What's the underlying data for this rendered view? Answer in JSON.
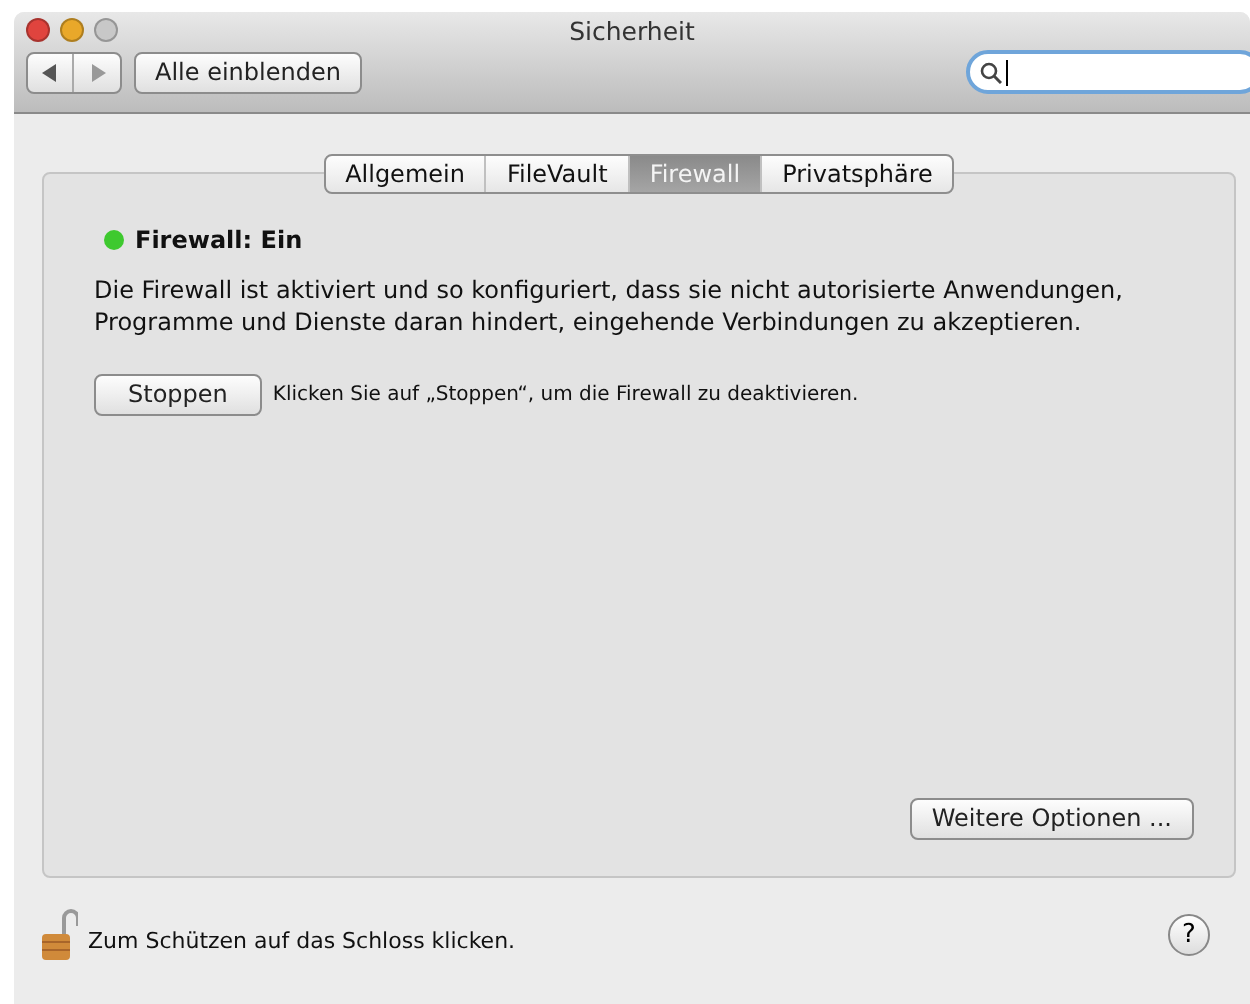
{
  "window": {
    "title": "Sicherheit"
  },
  "toolbar": {
    "show_all_button": "Alle einblenden",
    "search": {
      "cursor": true
    }
  },
  "tabs": [
    {
      "label": "Allgemein",
      "selected": false
    },
    {
      "label": "FileVault",
      "selected": false
    },
    {
      "label": "Firewall",
      "selected": true
    },
    {
      "label": "Privatsphäre",
      "selected": false
    }
  ],
  "firewall": {
    "on": true,
    "status": "Firewall: Ein",
    "description": "Die Firewall ist aktiviert und so konfiguriert, dass sie nicht autorisierte Anwendungen, Programme und Dienste daran hindert, eingehende Verbindungen zu akzeptieren.",
    "stop_button": "Stoppen",
    "stop_hint": "Klicken Sie auf „Stoppen“, um die Firewall zu deaktivieren.",
    "options_button": "Weitere Optionen ..."
  },
  "footer": {
    "locked": false,
    "lock_text": "Zum Schützen auf das Schloss klicken.",
    "help": "?"
  }
}
